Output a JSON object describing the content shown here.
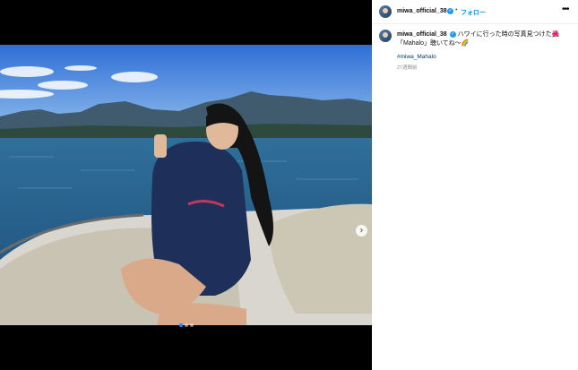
{
  "post": {
    "username": "miwa_official_38",
    "follow_label": "フォロー",
    "caption_text": "ハワイに行った時の写真見つけた🌺「Mahalo」聴いてね〜🌈",
    "hashtag": "#miwa_Mahalo",
    "time_ago": "27週間前",
    "media_index": 0,
    "media_count": 3
  },
  "icons": {
    "verified": "verified-badge-icon",
    "more": "more-options-icon",
    "next": "chevron-right-icon"
  },
  "colors": {
    "follow": "#0095f6",
    "verified": "#1d9bf0",
    "hashtag": "#00376b"
  }
}
